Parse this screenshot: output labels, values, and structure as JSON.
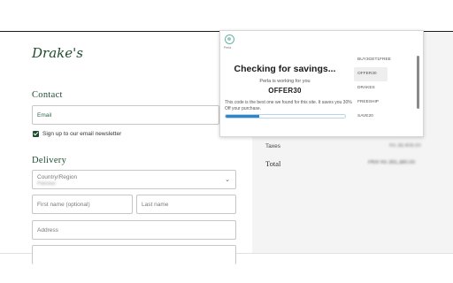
{
  "store": {
    "logo": "Drake's",
    "contact_title": "Contact",
    "email_placeholder": "Email",
    "newsletter_label": "Sign up to our email newsletter",
    "newsletter_checked": true,
    "delivery_title": "Delivery",
    "country_label": "Country/Region",
    "country_value": "Pakistan",
    "first_name_placeholder": "First name (optional)",
    "last_name_placeholder": "Last name",
    "address_placeholder": "Address"
  },
  "summary": {
    "taxes_label": "Taxes",
    "taxes_value": "Rs 38,408.00",
    "total_label": "Total",
    "total_currency": "PKR",
    "total_value": "Rs 391,380.00"
  },
  "extension": {
    "brand": "Perla",
    "heading": "Checking for savings...",
    "subheading": "Perla is working for you",
    "current_code": "OFFER30",
    "note": "This code is the best one we found for this site. It saves you 30% Off your purchase.",
    "progress": 0.28,
    "codes": [
      "BUY3GET1FREE",
      "OFFER30",
      "DRAKES",
      "FREESHIP",
      "SAVE20"
    ],
    "active_index": 1
  },
  "colors": {
    "brand_green": "#1f4d2e",
    "progress_blue": "#2f85c8",
    "panel_gray": "#f4f4f4"
  }
}
